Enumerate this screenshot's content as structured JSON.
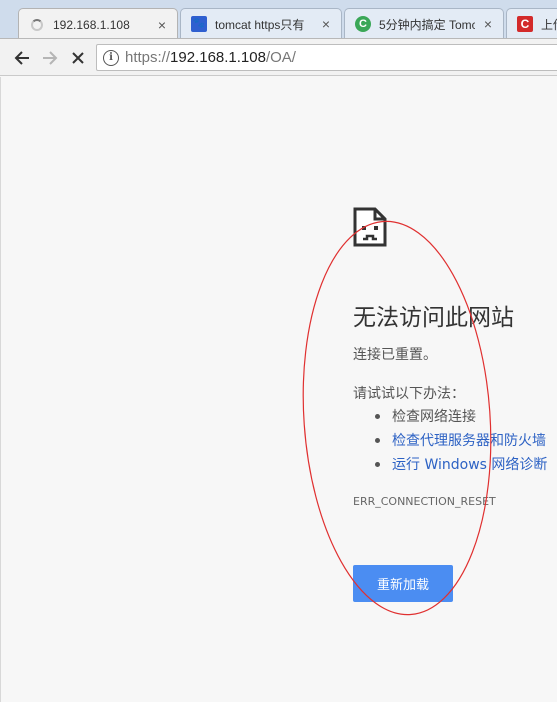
{
  "tabs": [
    {
      "title": "192.168.1.108",
      "close": "×",
      "favicon": "loading-spinner-icon"
    },
    {
      "title": "tomcat https只有",
      "close": "×",
      "favicon": "baidu-paw-icon"
    },
    {
      "title": "5分钟内搞定 Tomc",
      "close": "×",
      "favicon": "green-c-icon"
    },
    {
      "title": "上传",
      "close": "",
      "favicon": "red-c-icon"
    }
  ],
  "toolbar": {
    "back_icon": "back-arrow-icon",
    "forward_icon": "forward-arrow-icon",
    "stop_icon": "stop-x-icon",
    "info_icon": "i",
    "url_prefix": "https://",
    "url_host": "192.168.1.108",
    "url_path": "/OA/"
  },
  "error_page": {
    "icon": "sad-document-icon",
    "heading": "无法访问此网站",
    "subtext": "连接已重置。",
    "try_text": "请试试以下办法：",
    "suggestions": [
      {
        "text": "检查网络连接",
        "is_link": false
      },
      {
        "text": "检查代理服务器和防火墙",
        "is_link": true
      },
      {
        "text": "运行 Windows 网络诊断",
        "is_link": true
      }
    ],
    "error_code": "ERR_CONNECTION_RESET",
    "reload_button": "重新加载"
  },
  "colors": {
    "accent_button": "#4b8df2",
    "link": "#2d62c4",
    "annotation_ellipse": "#e03030"
  }
}
